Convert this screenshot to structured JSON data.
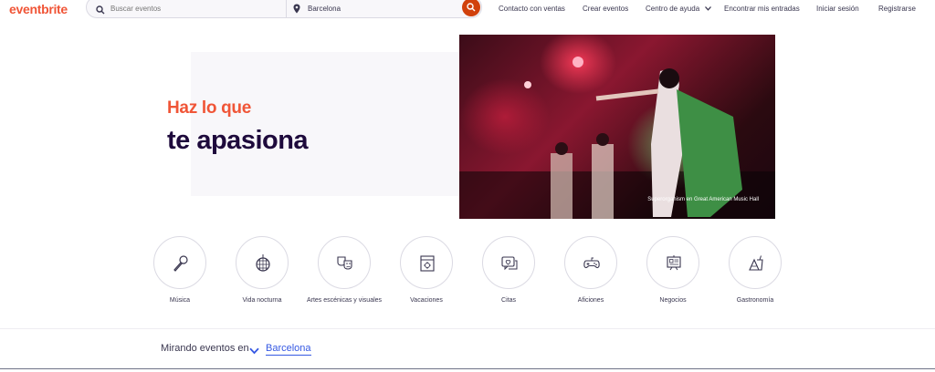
{
  "header": {
    "logo": "eventbrite",
    "search_placeholder": "Buscar eventos",
    "location_value": "Barcelona",
    "nav": {
      "contact_sales": "Contacto con ventas",
      "create_events": "Crear eventos",
      "help_center": "Centro de ayuda",
      "find_tickets": "Encontrar mis entradas",
      "login": "Iniciar sesión",
      "signup": "Registrarse"
    }
  },
  "hero": {
    "kicker": "Haz lo que",
    "title": "te apasiona",
    "image_caption": "Superorganism en Great American Music Hall"
  },
  "categories": [
    {
      "label": "Música",
      "icon": "microphone-icon"
    },
    {
      "label": "Vida nocturna",
      "icon": "disco-ball-icon"
    },
    {
      "label": "Artes escénicas y visuales",
      "icon": "theater-masks-icon"
    },
    {
      "label": "Vacaciones",
      "icon": "calendar-sun-icon"
    },
    {
      "label": "Citas",
      "icon": "chat-heart-icon"
    },
    {
      "label": "Aficiones",
      "icon": "gamepad-icon"
    },
    {
      "label": "Negocios",
      "icon": "presentation-board-icon"
    },
    {
      "label": "Gastronomía",
      "icon": "food-drink-icon"
    }
  ],
  "browsing": {
    "prefix": "Mirando eventos en",
    "city": "Barcelona"
  },
  "colors": {
    "brand": "#f05537",
    "search_button": "#d1410c",
    "link": "#3659e3",
    "text": "#1e0a3c"
  }
}
